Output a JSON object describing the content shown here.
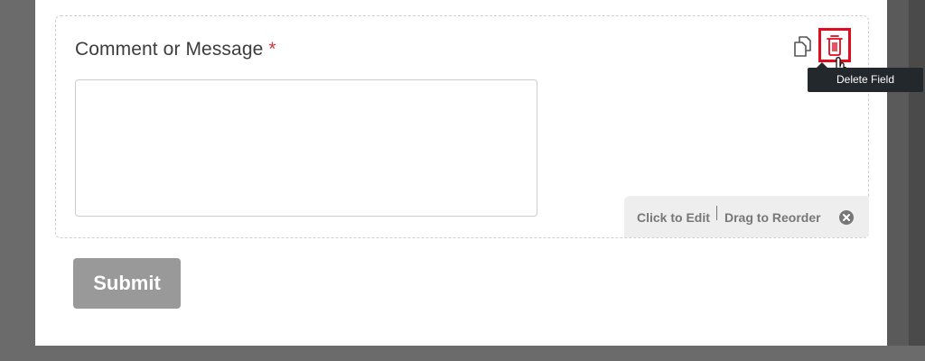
{
  "form": {
    "field_label": "Comment or Message",
    "required_mark": "*",
    "textarea_value": "",
    "submit_label": "Submit"
  },
  "field_actions": {
    "duplicate_icon": "duplicate-icon",
    "delete_icon": "trash-icon",
    "tooltip": "Delete Field"
  },
  "edit_hint": {
    "click_text": "Click to Edit",
    "drag_text": "Drag to Reorder",
    "close_icon": "close-circle-icon"
  },
  "colors": {
    "highlight": "#e00b1c",
    "required": "#d63638",
    "submit_bg": "#999999",
    "tooltip_bg": "#23282d"
  }
}
